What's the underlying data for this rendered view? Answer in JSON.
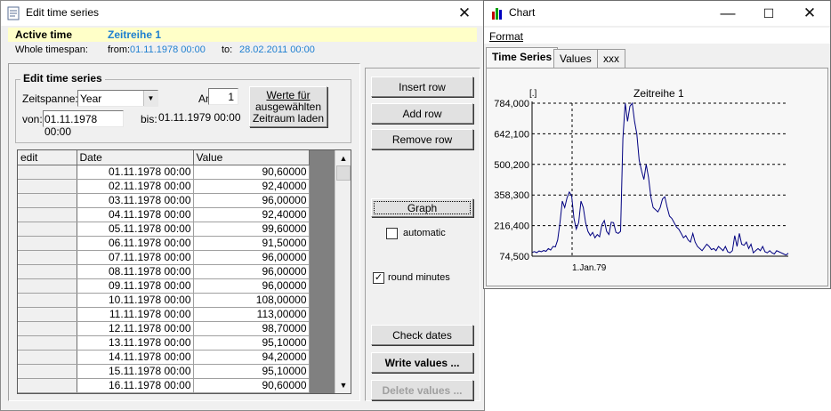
{
  "edit_window": {
    "title": "Edit time series",
    "active_time_label": "Active time",
    "active_series": "Zeitreihe 1",
    "whole_timespan_label": "Whole timespan:",
    "from_label": "from:",
    "from_value": "01.11.1978 00:00",
    "to_label": "to:",
    "to_value": "28.02.2011 00:00",
    "group_title": "Edit time series",
    "zeitspanne_label": "Zeitspanne:",
    "zeitspanne_value": "Year",
    "anzahl_label": "Anzahl:",
    "anzahl_value": "1",
    "load_button_line1": "Werte für",
    "load_button_line2": "ausgewählten",
    "load_button_line3": "Zeitraum laden",
    "von_label": "von:",
    "von_value": "01.11.1978 00:00",
    "bis_label": "bis:",
    "bis_value": "01.11.1979 00:00",
    "columns": [
      "edit",
      "Date",
      "Value"
    ],
    "rows": [
      {
        "date": "01.11.1978 00:00",
        "value": "90,60000"
      },
      {
        "date": "02.11.1978 00:00",
        "value": "92,40000"
      },
      {
        "date": "03.11.1978 00:00",
        "value": "96,00000"
      },
      {
        "date": "04.11.1978 00:00",
        "value": "92,40000"
      },
      {
        "date": "05.11.1978 00:00",
        "value": "99,60000"
      },
      {
        "date": "06.11.1978 00:00",
        "value": "91,50000"
      },
      {
        "date": "07.11.1978 00:00",
        "value": "96,00000"
      },
      {
        "date": "08.11.1978 00:00",
        "value": "96,00000"
      },
      {
        "date": "09.11.1978 00:00",
        "value": "96,00000"
      },
      {
        "date": "10.11.1978 00:00",
        "value": "108,00000"
      },
      {
        "date": "11.11.1978 00:00",
        "value": "113,00000"
      },
      {
        "date": "12.11.1978 00:00",
        "value": "98,70000"
      },
      {
        "date": "13.11.1978 00:00",
        "value": "95,10000"
      },
      {
        "date": "14.11.1978 00:00",
        "value": "94,20000"
      },
      {
        "date": "15.11.1978 00:00",
        "value": "95,10000"
      },
      {
        "date": "16.11.1978 00:00",
        "value": "90,60000"
      }
    ],
    "buttons": {
      "insert_row": "Insert row",
      "add_row": "Add row",
      "remove_row": "Remove row",
      "graph": "Graph",
      "check_dates": "Check dates",
      "write_values": "Write values ...",
      "delete_values": "Delete values ..."
    },
    "automatic_label": "automatic",
    "automatic_checked": false,
    "round_minutes_label": "round minutes",
    "round_minutes_checked": true
  },
  "chart_window": {
    "title": "Chart",
    "menu_format": "Format",
    "tabs": [
      "Time Series",
      "Values",
      "xxx"
    ],
    "active_tab": "Time Series"
  },
  "chart_data": {
    "type": "line",
    "title": "Zeitreihe 1",
    "ylabel": "[.]",
    "ylim": [
      74.5,
      784.0
    ],
    "yticks": [
      "784,000",
      "642,100",
      "500,200",
      "358,300",
      "216,400",
      "74,500"
    ],
    "xticks": [
      "1.Jan.79"
    ],
    "grid": true,
    "line_color": "#000080",
    "series": [
      {
        "values": [
          92,
          96,
          91,
          99,
          95,
          101,
          97,
          110,
          103,
          120,
          118,
          150,
          230,
          330,
          300,
          345,
          372,
          355,
          250,
          200,
          230,
          330,
          300,
          230,
          190,
          170,
          185,
          160,
          175,
          165,
          220,
          240,
          190,
          175,
          232,
          230,
          185,
          180,
          190,
          620,
          784,
          700,
          770,
          784,
          700,
          640,
          520,
          470,
          430,
          500,
          440,
          350,
          300,
          290,
          280,
          300,
          340,
          350,
          300,
          260,
          250,
          230,
          210,
          200,
          180,
          160,
          170,
          150,
          140,
          180,
          140,
          120,
          110,
          100,
          115,
          130,
          120,
          105,
          110,
          100,
          120,
          110,
          100,
          120,
          95,
          90,
          100,
          170,
          120,
          180,
          130,
          125,
          140,
          110,
          130,
          90,
          100,
          110,
          100,
          120,
          95,
          90,
          100,
          90,
          85,
          100,
          95,
          90,
          85,
          80,
          88
        ]
      }
    ]
  }
}
